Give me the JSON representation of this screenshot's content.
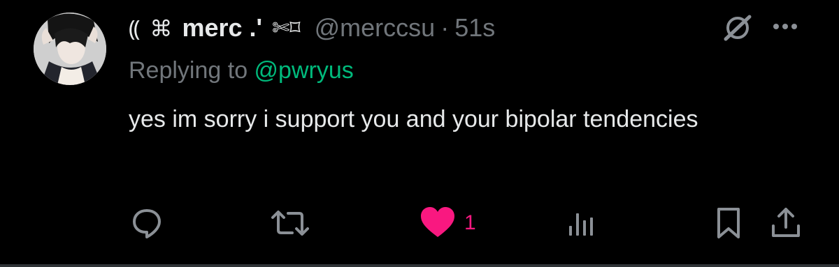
{
  "author": {
    "deco_prefix": "⸨ ⌘",
    "display_name": "merc .",
    "name_deco": "✄⌑",
    "handle": "@merccsu",
    "separator": "·",
    "time": "51s"
  },
  "reply": {
    "prefix": "Replying to ",
    "mention": "@pwryus"
  },
  "content": {
    "text": "yes im sorry i support you and your bipolar tendencies"
  },
  "actions": {
    "like_count": "1"
  },
  "colors": {
    "background": "#000000",
    "text": "#e7e9ea",
    "muted": "#71767b",
    "mention": "#00ba7c",
    "like": "#f91880"
  },
  "icons": [
    "grok-icon",
    "more-icon",
    "reply-icon",
    "retweet-icon",
    "heart-icon",
    "views-icon",
    "bookmark-icon",
    "share-icon"
  ]
}
